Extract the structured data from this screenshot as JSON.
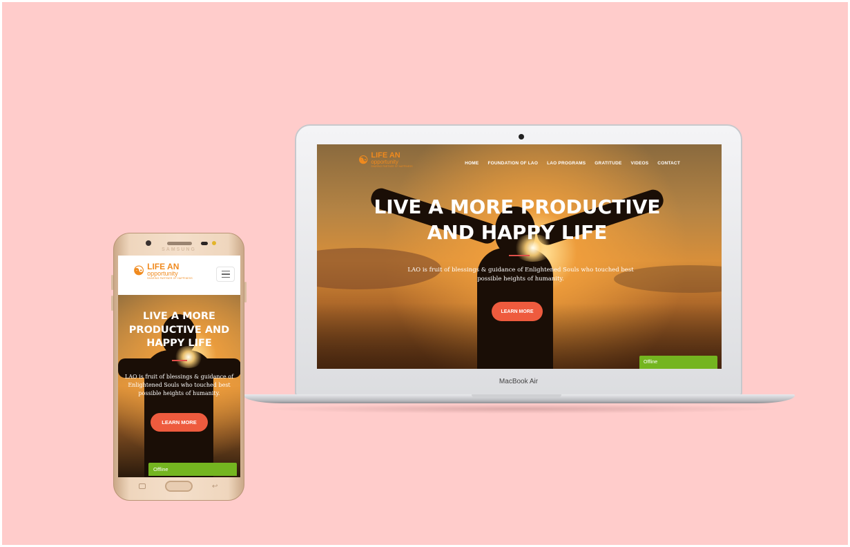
{
  "site": {
    "logo": {
      "line1": "LIFE AN",
      "line2": "opportunity",
      "tagline": "SHARING PARTNER OF HAPPINESS"
    },
    "nav": [
      "HOME",
      "FOUNDATION OF LAO",
      "LAO PROGRAMS",
      "GRATITUDE",
      "VIDEOS",
      "CONTACT"
    ],
    "hero": {
      "title_desktop_line1": "LIVE A MORE PRODUCTIVE",
      "title_desktop_line2": "AND HAPPY LIFE",
      "title_mobile_line1": "LIVE A MORE",
      "title_mobile_line2": "PRODUCTIVE AND",
      "title_mobile_line3": "HAPPY LIFE",
      "text_desktop_line1": "LAO is fruit of blessings & guidance of Enlightened Souls who touched best",
      "text_desktop_line2": "possible heights of humanity.",
      "text_mobile_line1": "LAO is fruit of blessings & guidance of",
      "text_mobile_line2": "Enlightened Souls who touched best",
      "text_mobile_line3": "possible heights of humanity.",
      "cta": "LEARN MORE"
    },
    "chat_status": "Offline"
  },
  "devices": {
    "laptop_label": "MacBook Air",
    "phone_label": "SAMSUNG"
  },
  "colors": {
    "background": "#ffcccb",
    "brand_orange": "#f08a1e",
    "cta": "#ee5b3e",
    "offline_green": "#74b520",
    "accent_line": "#e0504a"
  }
}
